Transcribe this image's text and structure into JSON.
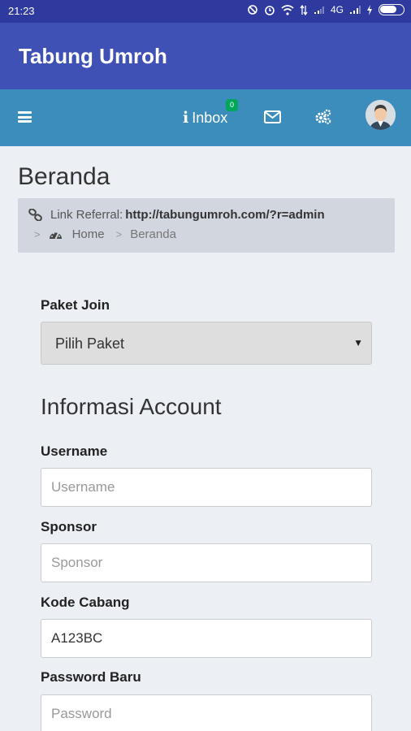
{
  "status_bar": {
    "time": "21:23",
    "network": "4G"
  },
  "app_bar": {
    "title": "Tabung Umroh"
  },
  "navbar": {
    "inbox_label": "Inbox",
    "inbox_badge": "0"
  },
  "page": {
    "title": "Beranda"
  },
  "breadcrumb": {
    "referral_label": "Link Referral:",
    "referral_url": "http://tabungumroh.com/?r=admin",
    "separator": ">",
    "home": "Home",
    "current": "Beranda"
  },
  "form": {
    "paket_label": "Paket Join",
    "paket_selected": "Pilih Paket",
    "section_title": "Informasi Account",
    "username_label": "Username",
    "username_placeholder": "Username",
    "sponsor_label": "Sponsor",
    "sponsor_placeholder": "Sponsor",
    "kode_cabang_label": "Kode Cabang",
    "kode_cabang_value": "A123BC",
    "password_label": "Password Baru",
    "password_placeholder": "Password"
  }
}
